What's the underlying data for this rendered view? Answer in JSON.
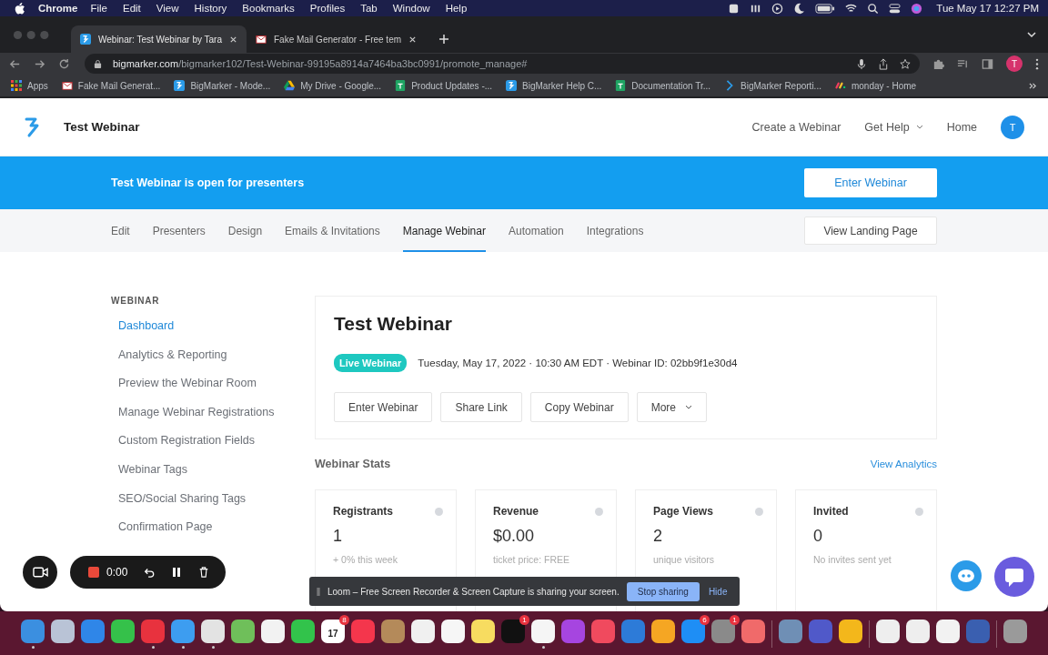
{
  "menubar": {
    "app": "Chrome",
    "menus": [
      "File",
      "Edit",
      "View",
      "History",
      "Bookmarks",
      "Profiles",
      "Tab",
      "Window",
      "Help"
    ],
    "clock": "Tue May 17  12:27 PM"
  },
  "browser": {
    "tabs": [
      {
        "title": "Webinar: Test Webinar by Tara",
        "selected": true
      },
      {
        "title": "Fake Mail Generator - Free tem",
        "selected": false
      }
    ],
    "url_host": "bigmarker.com",
    "url_path": "/bigmarker102/Test-Webinar-99195a8914a7464ba3bc0991/promote_manage#",
    "profile": "T",
    "bookmarks": [
      {
        "label": "Apps",
        "kind": "apps"
      },
      {
        "label": "Fake Mail Generat...",
        "kind": "mail"
      },
      {
        "label": "BigMarker - Mode...",
        "kind": "bigmarker"
      },
      {
        "label": "My Drive - Google...",
        "kind": "drive"
      },
      {
        "label": "Product Updates -...",
        "kind": "sheets"
      },
      {
        "label": "BigMarker Help C...",
        "kind": "bigmarker"
      },
      {
        "label": "Documentation Tr...",
        "kind": "sheets"
      },
      {
        "label": "BigMarker Reporti...",
        "kind": "reports"
      },
      {
        "label": "monday - Home",
        "kind": "monday"
      }
    ]
  },
  "header": {
    "title": "Test Webinar",
    "links": [
      {
        "label": "Create a Webinar",
        "dropdown": false
      },
      {
        "label": "Get Help",
        "dropdown": true
      },
      {
        "label": "Home",
        "dropdown": false
      }
    ],
    "avatar": "T"
  },
  "banner": {
    "message": "Test Webinar is open for presenters",
    "button": "Enter Webinar"
  },
  "nav": {
    "tabs": [
      {
        "label": "Edit",
        "selected": false
      },
      {
        "label": "Presenters",
        "selected": false
      },
      {
        "label": "Design",
        "selected": false
      },
      {
        "label": "Emails & Invitations",
        "selected": false
      },
      {
        "label": "Manage Webinar",
        "selected": true
      },
      {
        "label": "Automation",
        "selected": false
      },
      {
        "label": "Integrations",
        "selected": false
      }
    ],
    "button": "View Landing Page"
  },
  "sidebar": {
    "heading": "WEBINAR",
    "items": [
      {
        "label": "Dashboard",
        "selected": true
      },
      {
        "label": "Analytics & Reporting",
        "selected": false
      },
      {
        "label": "Preview the Webinar Room",
        "selected": false
      },
      {
        "label": "Manage Webinar Registrations",
        "selected": false
      },
      {
        "label": "Custom Registration Fields",
        "selected": false
      },
      {
        "label": "Webinar Tags",
        "selected": false
      },
      {
        "label": "SEO/Social Sharing Tags",
        "selected": false
      },
      {
        "label": "Confirmation Page",
        "selected": false
      }
    ]
  },
  "webinar": {
    "title": "Test Webinar",
    "badge": "Live Webinar",
    "details": "Tuesday, May 17, 2022 · 10:30 AM EDT · Webinar ID: 02bb9f1e30d4",
    "actions": [
      {
        "label": "Enter Webinar",
        "dropdown": false
      },
      {
        "label": "Share Link",
        "dropdown": false
      },
      {
        "label": "Copy Webinar",
        "dropdown": false
      },
      {
        "label": "More",
        "dropdown": true
      }
    ]
  },
  "stats": {
    "title": "Webinar Stats",
    "link": "View Analytics",
    "cards": [
      {
        "label": "Registrants",
        "value": "1",
        "note": "+ 0% this week"
      },
      {
        "label": "Revenue",
        "value": "$0.00",
        "note": "ticket price: FREE"
      },
      {
        "label": "Page Views",
        "value": "2",
        "note": "unique visitors"
      },
      {
        "label": "Invited",
        "value": "0",
        "note": "No invites sent yet"
      }
    ]
  },
  "recorder": {
    "time": "0:00"
  },
  "share_bar": {
    "message": "Loom – Free Screen Recorder & Screen Capture is sharing your screen.",
    "stop": "Stop sharing",
    "hide": "Hide"
  },
  "dock": [
    {
      "color": "#3b8fe0",
      "running": true
    },
    {
      "color": "#b9c3d6",
      "running": false
    },
    {
      "color": "#2f86e8",
      "running": false
    },
    {
      "color": "#35c14a",
      "running": false
    },
    {
      "color": "#e8323e",
      "running": true
    },
    {
      "color": "#3d9df0",
      "running": true
    },
    {
      "color": "#e3e3e3",
      "running": true
    },
    {
      "color": "#6fbf5a",
      "running": false
    },
    {
      "color": "#f2f2f2",
      "running": false
    },
    {
      "color": "#32c34b",
      "running": false
    },
    {
      "color": "#ffffff",
      "running": false,
      "badge": "8",
      "label": "17"
    },
    {
      "color": "#f4364c",
      "running": false
    },
    {
      "color": "#b48a5a",
      "running": false
    },
    {
      "color": "#f0f0f0",
      "running": false
    },
    {
      "color": "#f6f6f6",
      "running": false
    },
    {
      "color": "#f7dc60",
      "running": false
    },
    {
      "color": "#111111",
      "running": false,
      "badge": "1"
    },
    {
      "color": "#f5f5f5",
      "running": true
    },
    {
      "color": "#a645e0",
      "running": false
    },
    {
      "color": "#f04a5e",
      "running": false
    },
    {
      "color": "#2d7bd8",
      "running": false
    },
    {
      "color": "#f5a623",
      "running": false
    },
    {
      "color": "#1e8ef5",
      "running": false,
      "badge": "6"
    },
    {
      "color": "#8a8a8a",
      "running": false,
      "badge": "1"
    },
    {
      "color": "#f06a6a",
      "running": false
    },
    {
      "color": "#6f8fb5",
      "running": false,
      "sep": true
    },
    {
      "color": "#5059c9",
      "running": false
    },
    {
      "color": "#f3b71b",
      "running": false
    },
    {
      "color": "#eeeeee",
      "running": false,
      "sep": true
    },
    {
      "color": "#eeeeee",
      "running": false
    },
    {
      "color": "#f2f2f2",
      "running": false
    },
    {
      "color": "#3a5fb0",
      "running": false
    },
    {
      "color": "#9a9a9a",
      "running": false,
      "sep": true
    }
  ]
}
